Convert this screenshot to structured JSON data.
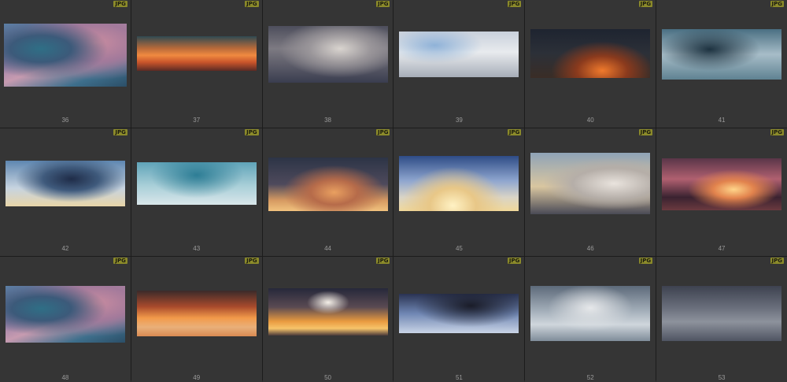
{
  "grid": {
    "badge_label": "JPG",
    "items": [
      {
        "number": "36",
        "bg": "radial-gradient(ellipse at 30% 40%, #2f6f86 0%, #3c5a7a 25%, transparent 55%), radial-gradient(ellipse at 75% 30%, #c98ca0 0%, #a37a9b 30%, transparent 60%), linear-gradient(160deg,#5a7fa5 0%, #9a7fa8 35%, #c79bb0 55%, #3e6f8c 80%, #2b4e67 100%)"
      },
      {
        "number": "37",
        "bg": "linear-gradient(180deg,#2f4a52 0%, #b86a3a 35%, #f08a40 55%, #c9552b 75%, #5a2a24 100%)"
      },
      {
        "number": "38",
        "bg": "radial-gradient(ellipse at 60% 40%, #d9d4cf 0%, #9a969a 30%, transparent 60%), linear-gradient(180deg,#4d4e5c 0%, #7d7a82 40%, #3a3d4f 100%)"
      },
      {
        "number": "39",
        "bg": "radial-gradient(ellipse at 30% 30%, #8fb2d8 0%, transparent 40%), linear-gradient(180deg,#c9d0db 0%, #e8ebee 45%, #a7adb8 100%)"
      },
      {
        "number": "40",
        "bg": "radial-gradient(ellipse at 60% 85%, #f07a2c 0%, #8a3a1d 25%, transparent 50%), linear-gradient(180deg,#1e2430 0%, #2c3038 50%, #3a2d26 100%)"
      },
      {
        "number": "41",
        "bg": "radial-gradient(ellipse at 40% 40%, #1d3240 0%, transparent 50%), linear-gradient(180deg,#4a6f82 0%, #a7bdc8 50%, #5f8292 100%)"
      },
      {
        "number": "42",
        "bg": "radial-gradient(ellipse at 55% 40%, #1f2c48 0%, #3f5a7c 30%, transparent 60%), linear-gradient(180deg,#5e86b0 0%, #c7d4e0 60%, #e8d5a8 100%)"
      },
      {
        "number": "43",
        "bg": "radial-gradient(ellipse at 50% 30%, #2d7d95 0%, transparent 55%), linear-gradient(180deg,#5fa3b8 0%, #a9cfd8 55%, #d9e6ea 100%)"
      },
      {
        "number": "44",
        "bg": "radial-gradient(ellipse at 55% 65%, #e9a060 0%, #b66b4a 25%, transparent 55%), linear-gradient(180deg,#2c3446 0%, #4e4a5c 50%, #d69a62 80%, #f1c27e 100%)"
      },
      {
        "number": "45",
        "bg": "radial-gradient(ellipse at 45% 90%, #fff2c4 0%, #e8c787 25%, transparent 55%), linear-gradient(180deg,#2e4c86 0%, #8fa6cf 45%, #d9d4c6 75%, #f0d89a 100%)"
      },
      {
        "number": "46",
        "bg": "radial-gradient(ellipse at 70% 50%, #e9e3dd 0%, #b5aea8 35%, transparent 60%), linear-gradient(180deg,#8fa3b7 0%, #d9c6a0 55%, #4a4a56 100%)"
      },
      {
        "number": "47",
        "bg": "radial-gradient(ellipse at 60% 60%, #ffd58a 0%, #e2834d 20%, transparent 45%), linear-gradient(180deg,#5a3548 0%, #b06070 40%, #3a2230 75%, #6b3a3f 100%)"
      },
      {
        "number": "48",
        "bg": "radial-gradient(ellipse at 30% 40%, #2f6f86 0%, #3c5a7a 25%, transparent 55%), radial-gradient(ellipse at 75% 30%, #c98ca0 0%, #a37a9b 30%, transparent 60%), linear-gradient(160deg,#5a7fa5 0%, #9a7fa8 35%, #c79bb0 55%, #3e6f8c 80%, #2b4e67 100%)"
      },
      {
        "number": "49",
        "bg": "linear-gradient(180deg,#3b2a2a 0%, #a84a2c 35%, #f29a4a 60%, #e9b07a 80%, #d98a52 100%)"
      },
      {
        "number": "50",
        "bg": "radial-gradient(ellipse at 50% 30%, #f5f0e8 0%, transparent 25%), linear-gradient(180deg,#26283a 0%, #5a4a52 40%, #e99a40 70%, #f7c46a 85%, #4a3a3a 100%)"
      },
      {
        "number": "51",
        "bg": "radial-gradient(ellipse at 60% 30%, #1a1c28 0%, transparent 55%), linear-gradient(180deg,#2a3352 0%, #6f86b3 50%, #c9d4e6 100%)"
      },
      {
        "number": "52",
        "bg": "radial-gradient(ellipse at 50% 40%, #e6e8ea 0%, transparent 50%), linear-gradient(180deg,#5d6a7a 0%, #a3aeb9 45%, #cfd6dc 70%, #7f8c99 100%)"
      },
      {
        "number": "53",
        "bg": "linear-gradient(180deg,#3d424f 0%, #6a6f7c 40%, #8d929c 65%, #4f5462 100%)"
      }
    ]
  }
}
